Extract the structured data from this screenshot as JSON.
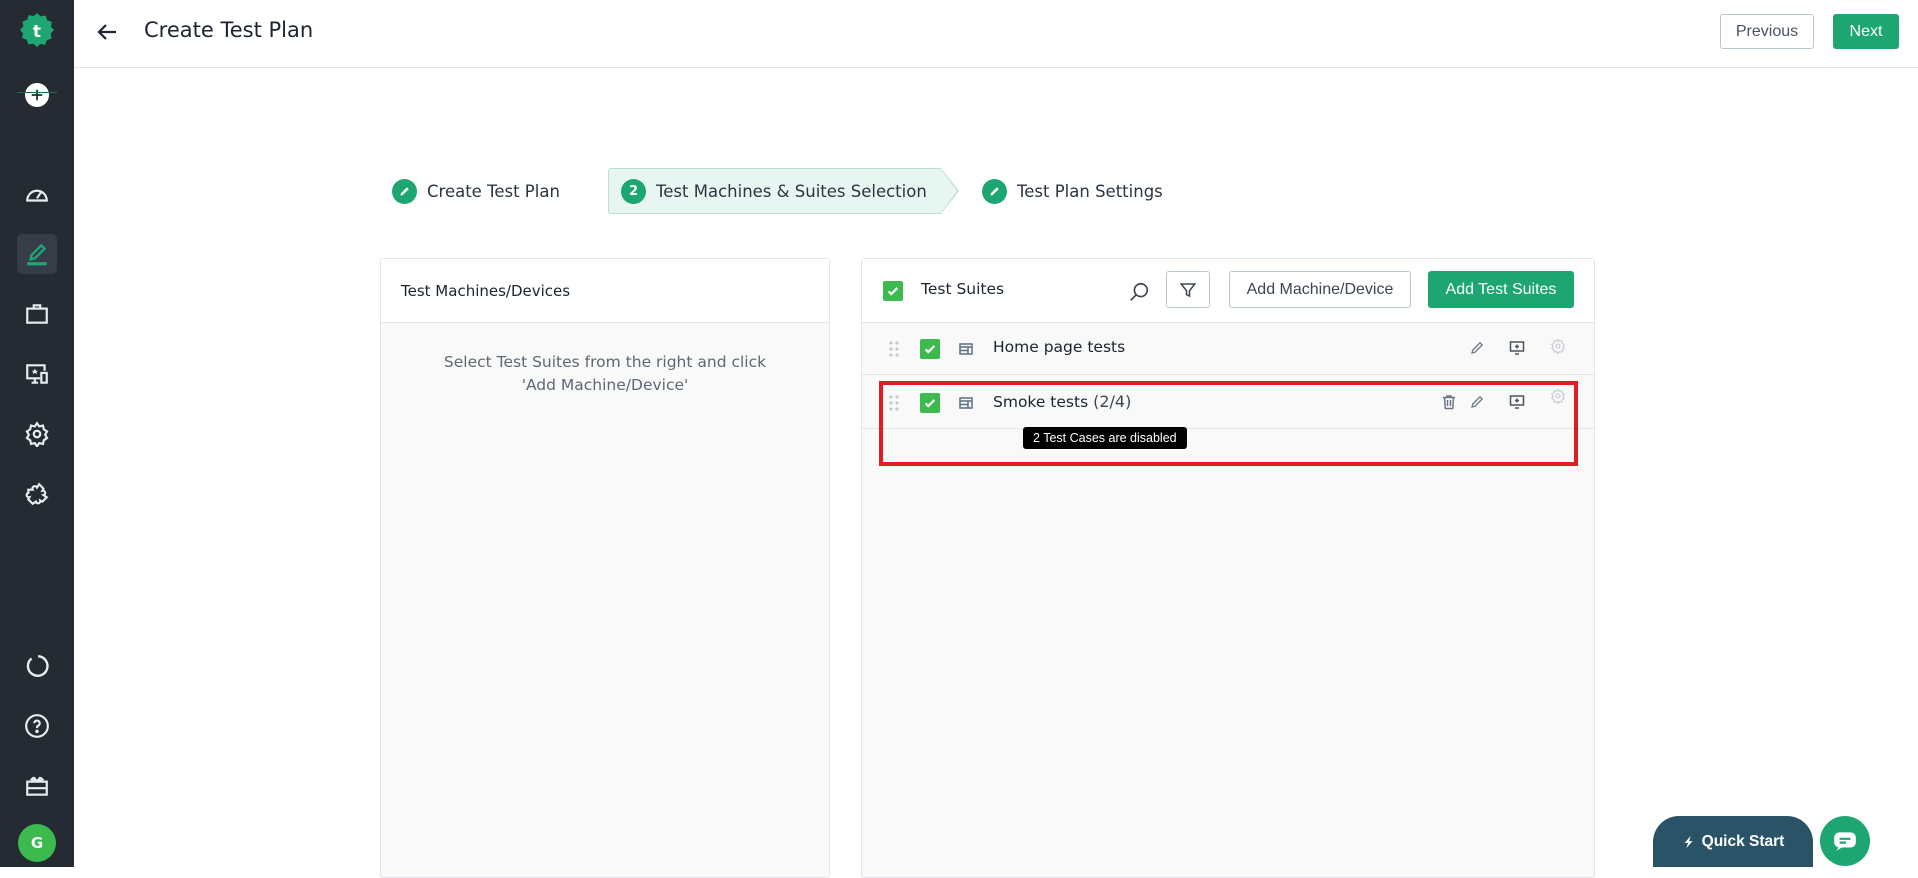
{
  "sidebar": {
    "logo": "testsigma-logo",
    "add_icon": "plus-circle-icon",
    "items": [
      {
        "name": "dashboard",
        "icon": "speedometer-icon",
        "active": false
      },
      {
        "name": "test-development",
        "icon": "pencil-icon",
        "active": true
      },
      {
        "name": "test-plans",
        "icon": "briefcase-icon",
        "active": false
      },
      {
        "name": "test-lab",
        "icon": "devices-icon",
        "active": false
      },
      {
        "name": "settings",
        "icon": "gear-icon",
        "active": false
      },
      {
        "name": "addons",
        "icon": "puzzle-icon",
        "active": false
      }
    ],
    "bottom_items": [
      {
        "name": "activity",
        "icon": "spinner-icon"
      },
      {
        "name": "help",
        "icon": "question-icon"
      },
      {
        "name": "whats-new",
        "icon": "gift-icon"
      }
    ],
    "avatar_initial": "G",
    "accent": "#1ea672"
  },
  "header": {
    "title": "Create Test Plan",
    "previous_label": "Previous",
    "next_label": "Next"
  },
  "stepper": {
    "steps": [
      {
        "label": "Create Test Plan",
        "state": "done",
        "badge": ""
      },
      {
        "label": "Test Machines & Suites Selection",
        "state": "active",
        "badge": "2"
      },
      {
        "label": "Test Plan Settings",
        "state": "done",
        "badge": ""
      }
    ]
  },
  "machines_panel": {
    "title": "Test Machines/Devices",
    "empty_message": "Select Test Suites from the right and click 'Add Machine/Device'"
  },
  "suites_panel": {
    "title": "Test Suites",
    "select_all_checked": true,
    "add_machine_label": "Add Machine/Device",
    "add_suites_label": "Add Test Suites",
    "rows": [
      {
        "name": "Home page tests",
        "count": "",
        "checked": true,
        "tooltip": ""
      },
      {
        "name": "Smoke tests",
        "count": "(2/4)",
        "checked": true,
        "tooltip": "2 Test Cases are disabled"
      }
    ]
  },
  "footer": {
    "quick_start_label": "Quick Start",
    "chat_icon": "chat-icon"
  },
  "colors": {
    "brand_green": "#1ea672",
    "checkbox_green": "#3dba4e",
    "sidebar_bg": "#252a33",
    "highlight_red": "#e31b23",
    "quick_start_bg": "#2b5367"
  }
}
